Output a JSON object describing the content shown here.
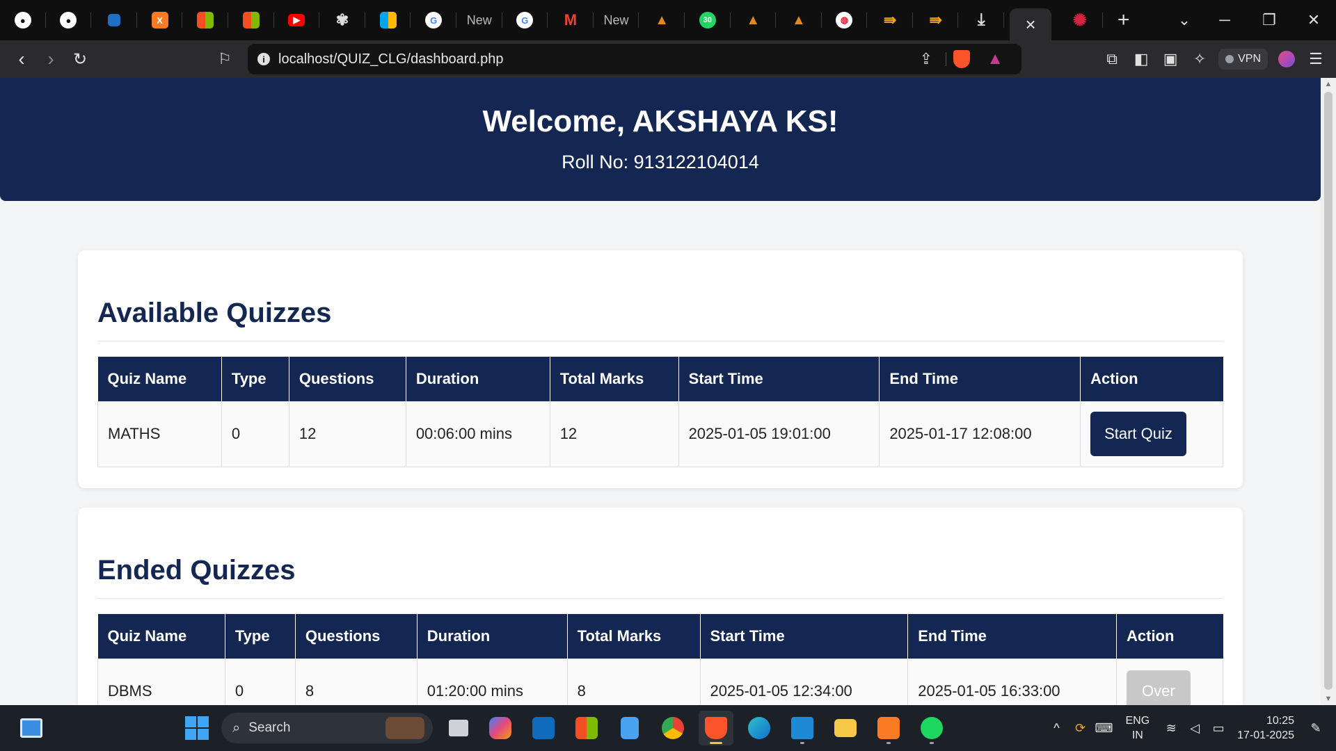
{
  "browser": {
    "tabs": [
      {
        "icon": "github-icon",
        "text": ""
      },
      {
        "icon": "github-icon",
        "text": ""
      },
      {
        "icon": "app-icon",
        "text": ""
      },
      {
        "icon": "xampp-icon",
        "text": ""
      },
      {
        "icon": "microsoft-icon",
        "text": ""
      },
      {
        "icon": "microsoft-icon",
        "text": ""
      },
      {
        "icon": "youtube-icon",
        "text": ""
      },
      {
        "icon": "chatgpt-icon",
        "text": ""
      },
      {
        "icon": "microsoft-icon",
        "text": ""
      },
      {
        "icon": "google-icon",
        "text": ""
      },
      {
        "icon": "newtab-icon",
        "text": "New"
      },
      {
        "icon": "google-icon",
        "text": ""
      },
      {
        "icon": "gmail-icon",
        "text": ""
      },
      {
        "icon": "newtab-icon",
        "text": "New"
      },
      {
        "icon": "college-icon",
        "text": ""
      },
      {
        "icon": "whatsapp-icon",
        "text": "30"
      },
      {
        "icon": "college-icon",
        "text": ""
      },
      {
        "icon": "college-icon",
        "text": ""
      },
      {
        "icon": "app-icon",
        "text": ""
      },
      {
        "icon": "arrow-icon",
        "text": ""
      },
      {
        "icon": "arrow-icon",
        "text": ""
      },
      {
        "icon": "download-icon",
        "text": ""
      }
    ],
    "url": "localhost/QUIZ_CLG/dashboard.php",
    "vpn_label": "VPN"
  },
  "header": {
    "welcome": "Welcome, AKSHAYA KS!",
    "roll": "Roll No: 913122104014"
  },
  "available": {
    "title": "Available Quizzes",
    "columns": [
      "Quiz Name",
      "Type",
      "Questions",
      "Duration",
      "Total Marks",
      "Start Time",
      "End Time",
      "Action"
    ],
    "rows": [
      {
        "name": "MATHS",
        "type": "0",
        "questions": "12",
        "duration": "00:06:00 mins",
        "marks": "12",
        "start": "2025-01-05 19:01:00",
        "end": "2025-01-17 12:08:00",
        "action": "Start Quiz"
      }
    ]
  },
  "ended": {
    "title": "Ended Quizzes",
    "columns": [
      "Quiz Name",
      "Type",
      "Questions",
      "Duration",
      "Total Marks",
      "Start Time",
      "End Time",
      "Action"
    ],
    "rows": [
      {
        "name": "DBMS",
        "type": "0",
        "questions": "8",
        "duration": "01:20:00 mins",
        "marks": "8",
        "start": "2025-01-05 12:34:00",
        "end": "2025-01-05 16:33:00",
        "action": "Over"
      }
    ]
  },
  "taskbar": {
    "search_placeholder": "Search",
    "lang_top": "ENG",
    "lang_bottom": "IN",
    "time": "10:25",
    "date": "17-01-2025"
  },
  "colors": {
    "primary": "#132752",
    "page_bg": "#f4f5f7",
    "disabled_btn": "#c8c8c8"
  }
}
